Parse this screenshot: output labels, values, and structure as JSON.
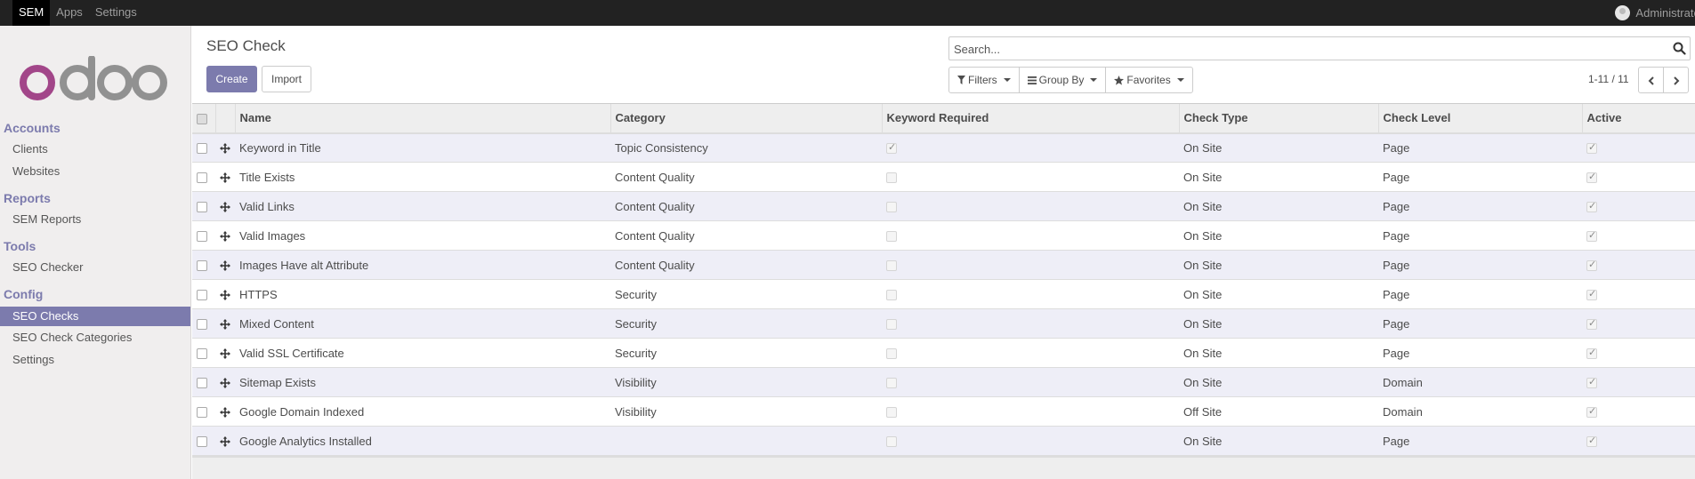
{
  "topbar": {
    "menu": [
      "SEM",
      "Apps",
      "Settings"
    ],
    "user": "Administrator"
  },
  "sidebar": {
    "logo": "odoo",
    "sections": [
      {
        "title": "Accounts",
        "items": [
          "Clients",
          "Websites"
        ]
      },
      {
        "title": "Reports",
        "items": [
          "SEM Reports"
        ]
      },
      {
        "title": "Tools",
        "items": [
          "SEO Checker"
        ]
      },
      {
        "title": "Config",
        "items": [
          "SEO Checks",
          "SEO Check Categories",
          "Settings"
        ]
      }
    ],
    "active_item": "SEO Checks"
  },
  "control": {
    "title": "SEO Check",
    "create_label": "Create",
    "import_label": "Import",
    "search_placeholder": "Search...",
    "filters_label": "Filters",
    "groupby_label": "Group By",
    "favorites_label": "Favorites",
    "pager": "1-11 / 11"
  },
  "table": {
    "columns": [
      "Name",
      "Category",
      "Keyword Required",
      "Check Type",
      "Check Level",
      "Active"
    ],
    "rows": [
      {
        "name": "Keyword in Title",
        "category": "Topic Consistency",
        "keyword_required": true,
        "check_type": "On Site",
        "check_level": "Page",
        "active": true
      },
      {
        "name": "Title Exists",
        "category": "Content Quality",
        "keyword_required": false,
        "check_type": "On Site",
        "check_level": "Page",
        "active": true
      },
      {
        "name": "Valid Links",
        "category": "Content Quality",
        "keyword_required": false,
        "check_type": "On Site",
        "check_level": "Page",
        "active": true
      },
      {
        "name": "Valid Images",
        "category": "Content Quality",
        "keyword_required": false,
        "check_type": "On Site",
        "check_level": "Page",
        "active": true
      },
      {
        "name": "Images Have alt Attribute",
        "category": "Content Quality",
        "keyword_required": false,
        "check_type": "On Site",
        "check_level": "Page",
        "active": true
      },
      {
        "name": "HTTPS",
        "category": "Security",
        "keyword_required": false,
        "check_type": "On Site",
        "check_level": "Page",
        "active": true
      },
      {
        "name": "Mixed Content",
        "category": "Security",
        "keyword_required": false,
        "check_type": "On Site",
        "check_level": "Page",
        "active": true
      },
      {
        "name": "Valid SSL Certificate",
        "category": "Security",
        "keyword_required": false,
        "check_type": "On Site",
        "check_level": "Page",
        "active": true
      },
      {
        "name": "Sitemap Exists",
        "category": "Visibility",
        "keyword_required": false,
        "check_type": "On Site",
        "check_level": "Domain",
        "active": true
      },
      {
        "name": "Google Domain Indexed",
        "category": "Visibility",
        "keyword_required": false,
        "check_type": "Off Site",
        "check_level": "Domain",
        "active": true
      },
      {
        "name": "Google Analytics Installed",
        "category": "",
        "keyword_required": false,
        "check_type": "On Site",
        "check_level": "Page",
        "active": true
      }
    ]
  }
}
